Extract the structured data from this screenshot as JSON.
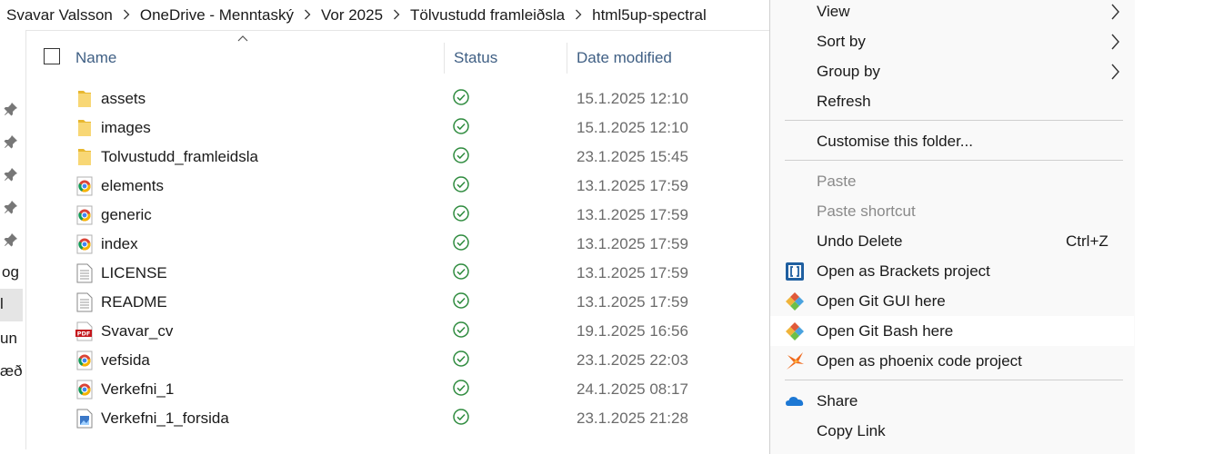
{
  "breadcrumb": [
    "Svavar Valsson",
    "OneDrive - Menntaský",
    "Vor 2025",
    "Tölvustudd framleiðsla",
    "html5up-spectral"
  ],
  "leftnav": {
    "texts": [
      "og",
      "l",
      "un",
      "æð"
    ]
  },
  "columns": {
    "name": "Name",
    "status": "Status",
    "date": "Date modified"
  },
  "files": [
    {
      "name": "assets",
      "icon": "folder-icon",
      "date": "15.1.2025 12:10"
    },
    {
      "name": "images",
      "icon": "folder-icon",
      "date": "15.1.2025 12:10"
    },
    {
      "name": "Tolvustudd_framleidsla",
      "icon": "folder-icon",
      "date": "23.1.2025 15:45"
    },
    {
      "name": "elements",
      "icon": "chrome-html-icon",
      "date": "13.1.2025 17:59"
    },
    {
      "name": "generic",
      "icon": "chrome-html-icon",
      "date": "13.1.2025 17:59"
    },
    {
      "name": "index",
      "icon": "chrome-html-icon",
      "date": "13.1.2025 17:59"
    },
    {
      "name": "LICENSE",
      "icon": "text-file-icon",
      "date": "13.1.2025 17:59"
    },
    {
      "name": "README",
      "icon": "text-file-icon",
      "date": "13.1.2025 17:59"
    },
    {
      "name": "Svavar_cv",
      "icon": "pdf-icon",
      "date": "19.1.2025 16:56"
    },
    {
      "name": "vefsida",
      "icon": "chrome-html-icon",
      "date": "23.1.2025 22:03"
    },
    {
      "name": "Verkefni_1",
      "icon": "chrome-html-icon",
      "date": "24.1.2025 08:17"
    },
    {
      "name": "Verkefni_1_forsida",
      "icon": "image-file-icon",
      "date": "23.1.2025 21:28"
    }
  ],
  "context_menu": {
    "view": "View",
    "sort_by": "Sort by",
    "group_by": "Group by",
    "refresh": "Refresh",
    "customise": "Customise this folder...",
    "paste": "Paste",
    "paste_shortcut": "Paste shortcut",
    "undo_delete": "Undo Delete",
    "undo_shortcut": "Ctrl+Z",
    "brackets": "Open as Brackets project",
    "git_gui": "Open Git GUI here",
    "git_bash": "Open Git Bash here",
    "phoenix": "Open as phoenix code project",
    "share": "Share",
    "copy_link": "Copy Link"
  },
  "colors": {
    "header_text": "#3f5f84",
    "status_green": "#2e8b3e",
    "folder_yellow": "#f8d775"
  }
}
